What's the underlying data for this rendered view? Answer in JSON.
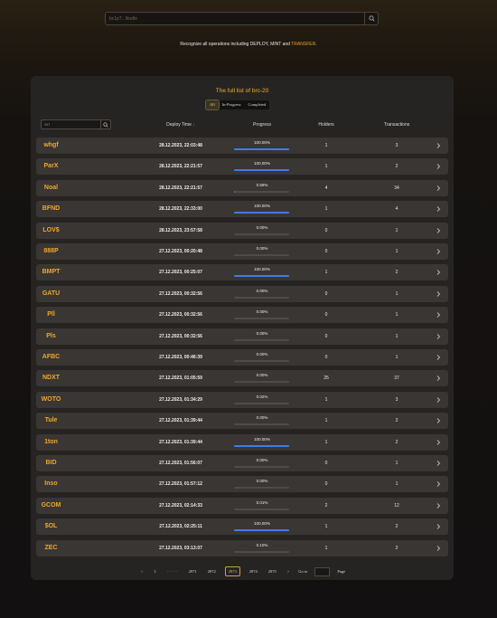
{
  "search": {
    "placeholder": "bc1p7...Nodle"
  },
  "note": {
    "prefix": "Recognize all operations including DEPLOY, MINT and ",
    "highlight": "TRANSFER",
    "suffix": "."
  },
  "panel": {
    "title": "The full list of brc-20",
    "filters": [
      "All",
      "In-Progress",
      "Completed"
    ],
    "active_filter": "All",
    "search_placeholder": "wrt",
    "columns": {
      "deploy_time": "Deploy Time",
      "progress": "Progress",
      "holders": "Holders",
      "transactions": "Transactions"
    },
    "sort_arrow": "↓"
  },
  "rows": [
    {
      "tick": "whgf",
      "time": "28.12.2023, 22:03:48",
      "progress": "100.00%",
      "pct": 1.0,
      "holders": "1",
      "tx": "3"
    },
    {
      "tick": "ParX",
      "time": "28.12.2023, 22:21:57",
      "progress": "100.00%",
      "pct": 1.0,
      "holders": "1",
      "tx": "2"
    },
    {
      "tick": "Noal",
      "time": "28.12.2023, 22:21:57",
      "progress": "0.59%",
      "pct": 0.0059,
      "holders": "4",
      "tx": "34"
    },
    {
      "tick": "BFND",
      "time": "28.12.2023, 22:33:00",
      "progress": "100.00%",
      "pct": 1.0,
      "holders": "1",
      "tx": "4"
    },
    {
      "tick": "LOV$",
      "time": "28.12.2023, 23:57:58",
      "progress": "0.00%",
      "pct": 0,
      "holders": "0",
      "tx": "1"
    },
    {
      "tick": "888P",
      "time": "27.12.2023, 00:20:48",
      "progress": "0.00%",
      "pct": 0,
      "holders": "0",
      "tx": "1"
    },
    {
      "tick": "BMPT",
      "time": "27.12.2023, 00:25:07",
      "progress": "100.00%",
      "pct": 1.0,
      "holders": "1",
      "tx": "2"
    },
    {
      "tick": "GATU",
      "time": "27.12.2023, 00:32:56",
      "progress": "0.00%",
      "pct": 0,
      "holders": "0",
      "tx": "1"
    },
    {
      "tick": "Pll",
      "time": "27.12.2023, 00:32:56",
      "progress": "0.00%",
      "pct": 0,
      "holders": "0",
      "tx": "1"
    },
    {
      "tick": "Pls",
      "time": "27.12.2023, 00:32:56",
      "progress": "0.00%",
      "pct": 0,
      "holders": "0",
      "tx": "1"
    },
    {
      "tick": "AFBC",
      "time": "27.12.2023, 00:46:39",
      "progress": "0.00%",
      "pct": 0,
      "holders": "0",
      "tx": "1"
    },
    {
      "tick": "NDXT",
      "time": "27.12.2023, 01:05:59",
      "progress": "0.00%",
      "pct": 0,
      "holders": "25",
      "tx": "37"
    },
    {
      "tick": "WOTO",
      "time": "27.12.2023, 01:34:29",
      "progress": "0.02%",
      "pct": 0.0002,
      "holders": "1",
      "tx": "3"
    },
    {
      "tick": "Tule",
      "time": "27.12.2023, 01:39:44",
      "progress": "0.00%",
      "pct": 0,
      "holders": "1",
      "tx": "2"
    },
    {
      "tick": "1ton",
      "time": "27.12.2023, 01:39:44",
      "progress": "100.00%",
      "pct": 1.0,
      "holders": "1",
      "tx": "2"
    },
    {
      "tick": "BID",
      "time": "27.12.2023, 01:56:07",
      "progress": "0.00%",
      "pct": 0,
      "holders": "0",
      "tx": "1"
    },
    {
      "tick": "Inso",
      "time": "27.12.2023, 01:57:12",
      "progress": "0.00%",
      "pct": 0,
      "holders": "0",
      "tx": "1"
    },
    {
      "tick": "GCOM",
      "time": "27.12.2023, 02:14:33",
      "progress": "0.01%",
      "pct": 0.0001,
      "holders": "2",
      "tx": "12"
    },
    {
      "tick": "$OL",
      "time": "27.12.2023, 02:25:11",
      "progress": "100.00%",
      "pct": 1.0,
      "holders": "1",
      "tx": "2"
    },
    {
      "tick": "ZEC",
      "time": "27.12.2023, 03:13:07",
      "progress": "0.10%",
      "pct": 0.001,
      "holders": "1",
      "tx": "2"
    }
  ],
  "pager": {
    "prev": "<",
    "first": "1",
    "ellipsis": "· · · · ·",
    "pages": [
      "2971",
      "2972",
      "2973",
      "2974",
      "2975"
    ],
    "current": "2973",
    "next": ">",
    "goto_label": "Go to",
    "page_label": "Page"
  },
  "colors": {
    "accent": "#f0a828",
    "progress_fill": "#3f7de0",
    "highlight": "#f0a020"
  },
  "icons": {
    "search": "search-icon",
    "row_arrow": "chevron-right-icon"
  }
}
